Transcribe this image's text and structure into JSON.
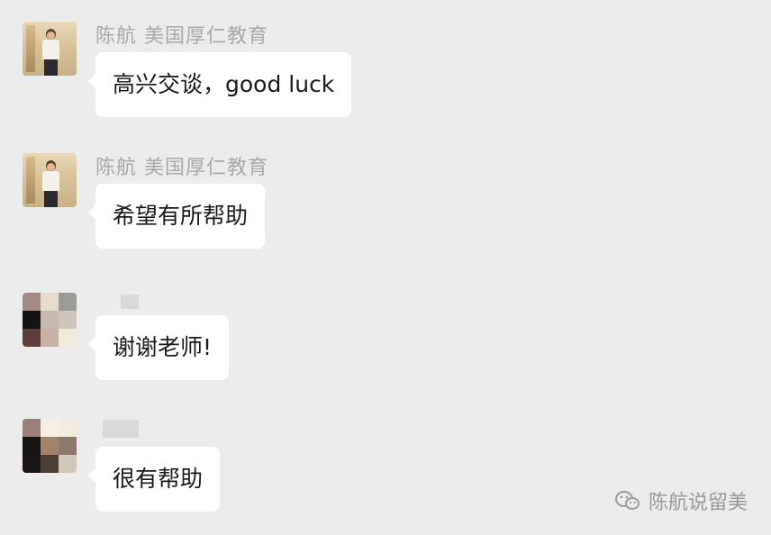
{
  "messages": [
    {
      "sender": "陈航 美国厚仁教育",
      "text": "高兴交谈，good luck",
      "avatar_icon": "person-photo-avatar"
    },
    {
      "sender": "陈航 美国厚仁教育",
      "text": "希望有所帮助",
      "avatar_icon": "person-photo-avatar"
    },
    {
      "sender": "",
      "text": "谢谢老师!",
      "avatar_icon": "pixelated-avatar",
      "avatar_colors": [
        "#a48a82",
        "#e7ddcf",
        "#9b9b97",
        "#151213",
        "#c9b9ad",
        "#cfc6bb",
        "#5d3e3a",
        "#c7b2a3",
        "#f0eadf"
      ]
    },
    {
      "sender": "",
      "text": "很有帮助",
      "avatar_icon": "pixelated-avatar",
      "avatar_colors": [
        "#9a8078",
        "#f6efe2",
        "#f4ecdf",
        "#171414",
        "#a1826b",
        "#8e7a6c",
        "#1b1716",
        "#4c3d36",
        "#d2c7bb"
      ]
    }
  ],
  "watermark": {
    "text": "陈航说留美",
    "icon": "wechat-official-account-icon"
  }
}
